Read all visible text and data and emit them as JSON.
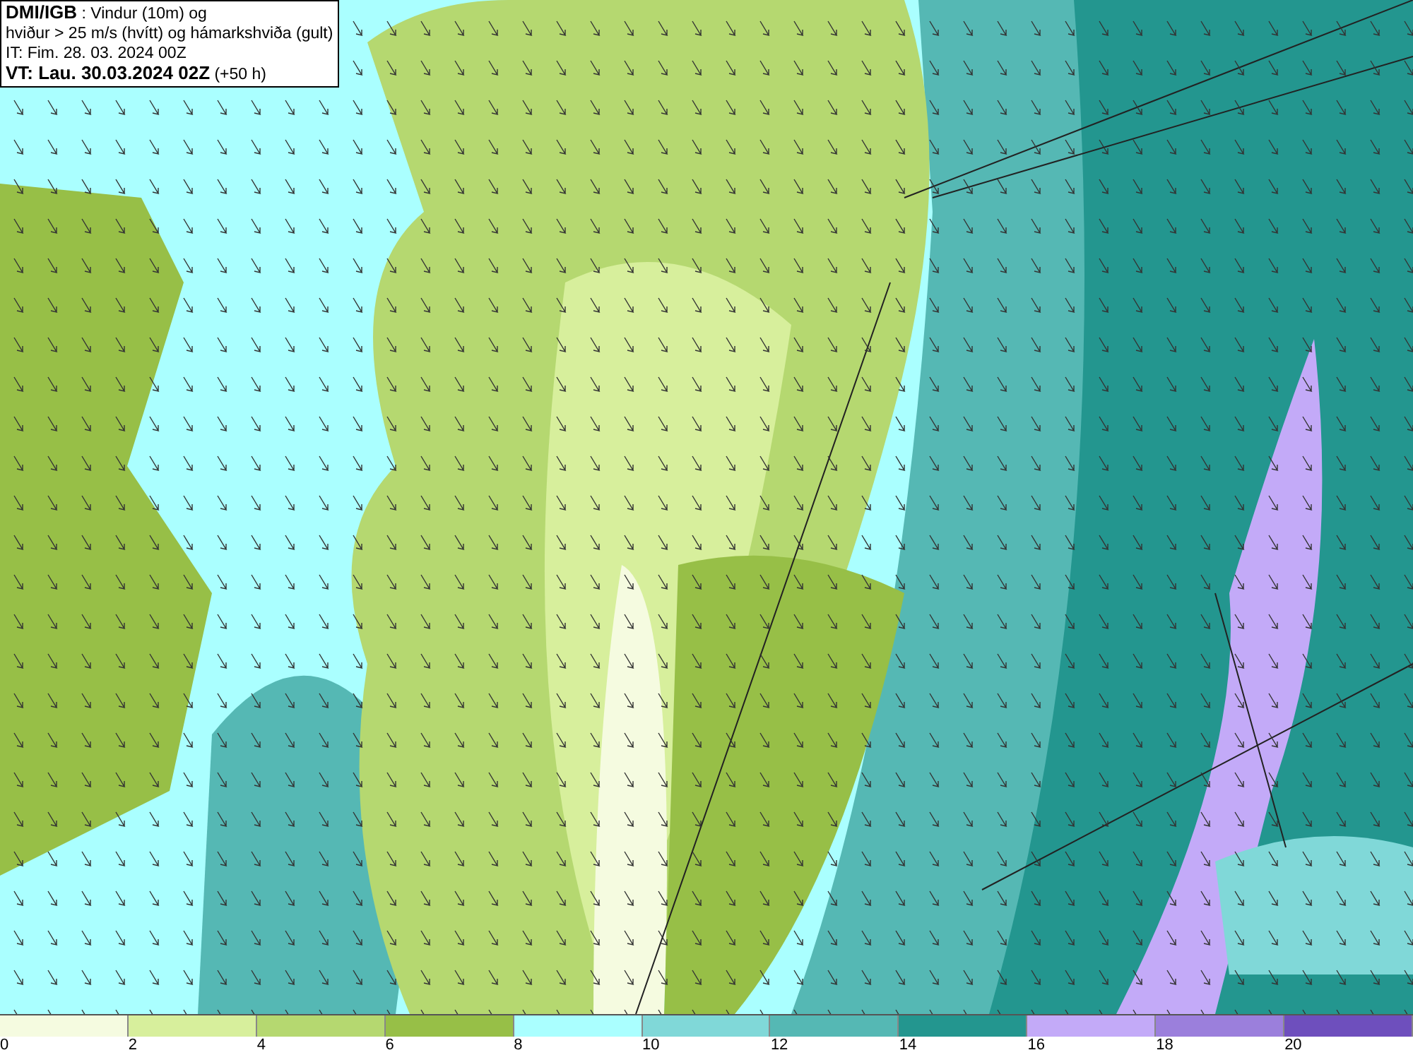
{
  "title_box": {
    "lines": [
      "**DMI/IGB** : Vindur (10m) og",
      "hviður > 25 m/s (hvítt) og hámarkshviða (gult)",
      "IT: Fim. 28. 03. 2024 00Z",
      "**VT: Lau. 30.03.2024 02Z** (+50 h)"
    ]
  },
  "legend": {
    "bins": [
      {
        "color": "#f5fbe0"
      },
      {
        "color": "#d7ef9c"
      },
      {
        "color": "#b5d870"
      },
      {
        "color": "#97bf47"
      },
      {
        "color": "#aaffff"
      },
      {
        "color": "#80d8d8"
      },
      {
        "color": "#55b8b4"
      },
      {
        "color": "#23968f"
      },
      {
        "color": "#c3aaf8"
      },
      {
        "color": "#9b7fdc"
      },
      {
        "color": "#6e4fbd"
      }
    ],
    "ticks": [
      "0",
      "2",
      "4",
      "6",
      "8",
      "10",
      "12",
      "14",
      "16",
      "18",
      "20"
    ]
  }
}
